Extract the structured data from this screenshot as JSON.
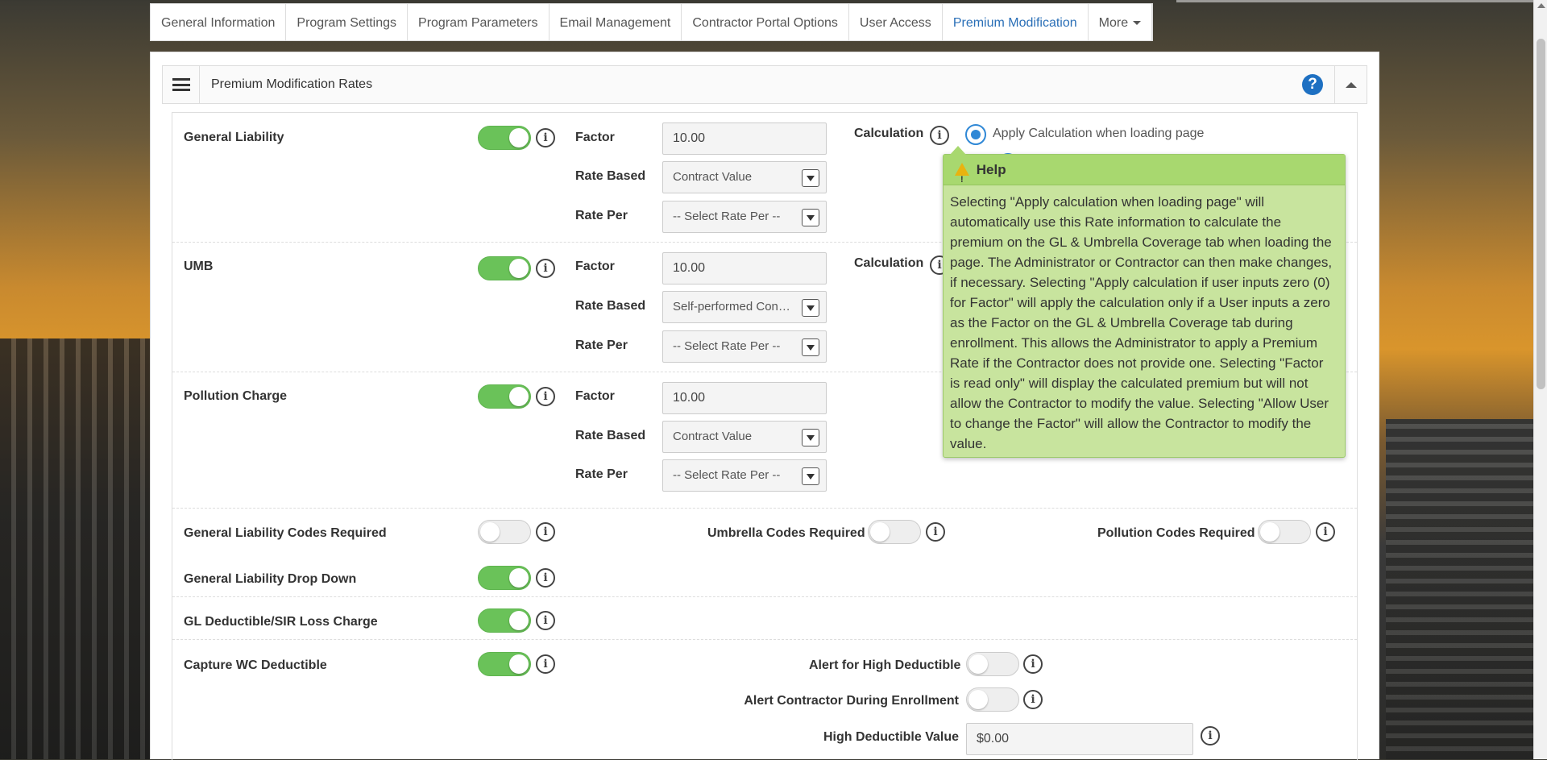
{
  "tabs": [
    {
      "label": "General Information"
    },
    {
      "label": "Program Settings"
    },
    {
      "label": "Program Parameters"
    },
    {
      "label": "Email Management"
    },
    {
      "label": "Contractor Portal Options"
    },
    {
      "label": "User Access"
    },
    {
      "label": "Premium Modification"
    },
    {
      "label": "More"
    }
  ],
  "panel": {
    "title": "Premium Modification Rates",
    "help_icon": "question-circle-icon",
    "collapse_icon": "chevron-up-icon"
  },
  "field_labels": {
    "factor": "Factor",
    "rate_based": "Rate Based",
    "rate_per": "Rate Per",
    "calculation": "Calculation"
  },
  "sections": [
    {
      "label": "General Liability",
      "enabled": true,
      "factor": "10.00",
      "rate_based": "Contract Value",
      "rate_per": "-- Select Rate Per --"
    },
    {
      "label": "UMB",
      "enabled": true,
      "factor": "10.00",
      "rate_based": "Self-performed Contract Value",
      "rate_per": "-- Select Rate Per --"
    },
    {
      "label": "Pollution Charge",
      "enabled": true,
      "factor": "10.00",
      "rate_based": "Contract Value",
      "rate_per": "-- Select Rate Per --"
    }
  ],
  "calculation_option": "Apply Calculation when loading page",
  "codes": {
    "gl_codes_required": {
      "label": "General Liability Codes Required",
      "enabled": false
    },
    "umbrella_codes_required": {
      "label": "Umbrella Codes Required",
      "enabled": false
    },
    "pollution_codes_required": {
      "label": "Pollution Codes Required",
      "enabled": false
    }
  },
  "settings": {
    "gl_drop_down": {
      "label": "General Liability Drop Down",
      "enabled": true
    },
    "gl_deductible": {
      "label": "GL Deductible/SIR Loss Charge",
      "enabled": true
    },
    "capture_wc": {
      "label": "Capture WC Deductible",
      "enabled": true
    },
    "alert_high_deductible": {
      "label": "Alert for High Deductible",
      "enabled": false
    },
    "alert_contractor": {
      "label": "Alert Contractor During Enrollment",
      "enabled": false
    },
    "high_deductible_value": {
      "label": "High Deductible Value",
      "value": "$0.00"
    }
  },
  "popover": {
    "title": "Help",
    "body": "Selecting \"Apply calculation when loading page\" will automatically use this Rate information to calculate the premium on the GL & Umbrella Coverage tab when loading the page. The Administrator or Contractor can then make changes, if necessary. Selecting \"Apply calculation if user inputs zero (0) for Factor\" will apply the calculation only if a User inputs a zero as the Factor on the GL & Umbrella Coverage tab during enrollment. This allows the Administrator to apply a Premium Rate if the Contractor does not provide one. Selecting \"Factor is read only\" will display the calculated premium but will not allow the Contractor to modify the value. Selecting \"Allow User to change the Factor\" will allow the Contractor to modify the value."
  },
  "info_glyph": "i",
  "colors": {
    "accent": "#2a6fb7",
    "toggle_on": "#6ac259",
    "popover_bg": "#c8e49e",
    "popover_header": "#a8d86f"
  }
}
